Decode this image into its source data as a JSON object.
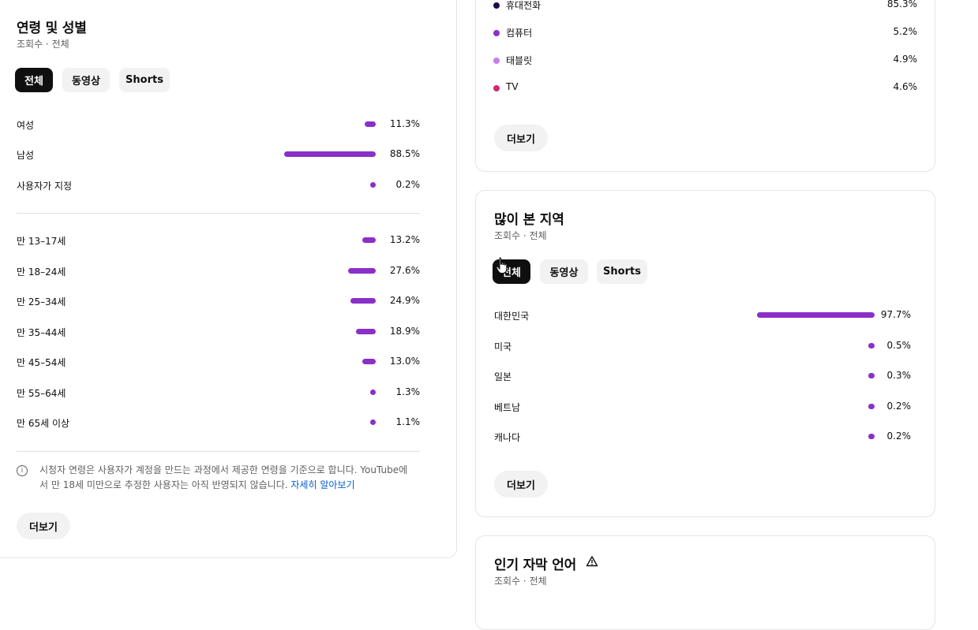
{
  "age_gender": {
    "title": "연령 및 성별",
    "subtitle": "조회수 · 전체",
    "chips": [
      "전체",
      "동영상",
      "Shorts"
    ],
    "gender_rows": [
      {
        "label": "여성",
        "value": "11.3%",
        "pct": 11.3
      },
      {
        "label": "남성",
        "value": "88.5%",
        "pct": 88.5
      },
      {
        "label": "사용자가 지정",
        "value": "0.2%",
        "pct": 0.2
      }
    ],
    "age_rows": [
      {
        "label": "만 13–17세",
        "value": "13.2%",
        "pct": 13.2
      },
      {
        "label": "만 18–24세",
        "value": "27.6%",
        "pct": 27.6
      },
      {
        "label": "만 25–34세",
        "value": "24.9%",
        "pct": 24.9
      },
      {
        "label": "만 35–44세",
        "value": "18.9%",
        "pct": 18.9
      },
      {
        "label": "만 45–54세",
        "value": "13.0%",
        "pct": 13.0
      },
      {
        "label": "만 55–64세",
        "value": "1.3%",
        "pct": 1.3
      },
      {
        "label": "만 65세 이상",
        "value": "1.1%",
        "pct": 1.1
      }
    ],
    "note_line1": "시청자 연령은 사용자가 계정을 만드는 과정에서 제공한 연령을 기준으로 합니다. YouTube에",
    "note_line2": "서 만 18세 미만으로 추정한 사용자는 아직 반영되지 않습니다.",
    "note_link": "자세히 알아보기",
    "more": "더보기"
  },
  "devices": {
    "rows": [
      {
        "label": "휴대전화",
        "value": "85.3%",
        "color": "#1c0a4a"
      },
      {
        "label": "컴퓨터",
        "value": "5.2%",
        "color": "#8b2fc9"
      },
      {
        "label": "태블릿",
        "value": "4.9%",
        "color": "#c77dee"
      },
      {
        "label": "TV",
        "value": "4.6%",
        "color": "#d6266f"
      }
    ],
    "more": "더보기"
  },
  "regions": {
    "title": "많이 본 지역",
    "subtitle": "조회수 · 전체",
    "chips": [
      "전체",
      "동영상",
      "Shorts"
    ],
    "rows": [
      {
        "label": "대한민국",
        "value": "97.7%",
        "pct": 97.7
      },
      {
        "label": "미국",
        "value": "0.5%",
        "pct": 0.5
      },
      {
        "label": "일본",
        "value": "0.3%",
        "pct": 0.3
      },
      {
        "label": "베트남",
        "value": "0.2%",
        "pct": 0.2
      },
      {
        "label": "캐나다",
        "value": "0.2%",
        "pct": 0.2
      }
    ],
    "more": "더보기"
  },
  "subtitles": {
    "title": "인기 자막 언어",
    "subtitle": "조회수 · 전체",
    "warning_icon": "warning-icon"
  }
}
